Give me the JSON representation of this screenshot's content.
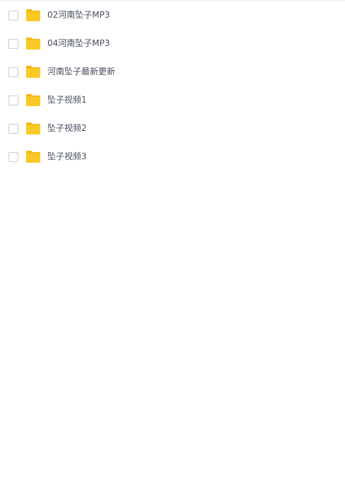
{
  "file_list": {
    "items": [
      {
        "name": "02河南坠子MP3",
        "icon": "folder-icon",
        "checked": false
      },
      {
        "name": "04河南坠子MP3",
        "icon": "folder-icon",
        "checked": false
      },
      {
        "name": "河南坠子最新更新",
        "icon": "folder-icon",
        "checked": false
      },
      {
        "name": "坠子视频1",
        "icon": "folder-icon",
        "checked": false
      },
      {
        "name": "坠子视频2",
        "icon": "folder-icon",
        "checked": false
      },
      {
        "name": "坠子视频3",
        "icon": "folder-icon",
        "checked": false
      }
    ]
  },
  "colors": {
    "folder": "#f9c926",
    "folder_tab": "#f6b617",
    "text": "#454d5a",
    "checkbox_border": "#c9cbd0",
    "top_border": "#f3f3f5"
  }
}
